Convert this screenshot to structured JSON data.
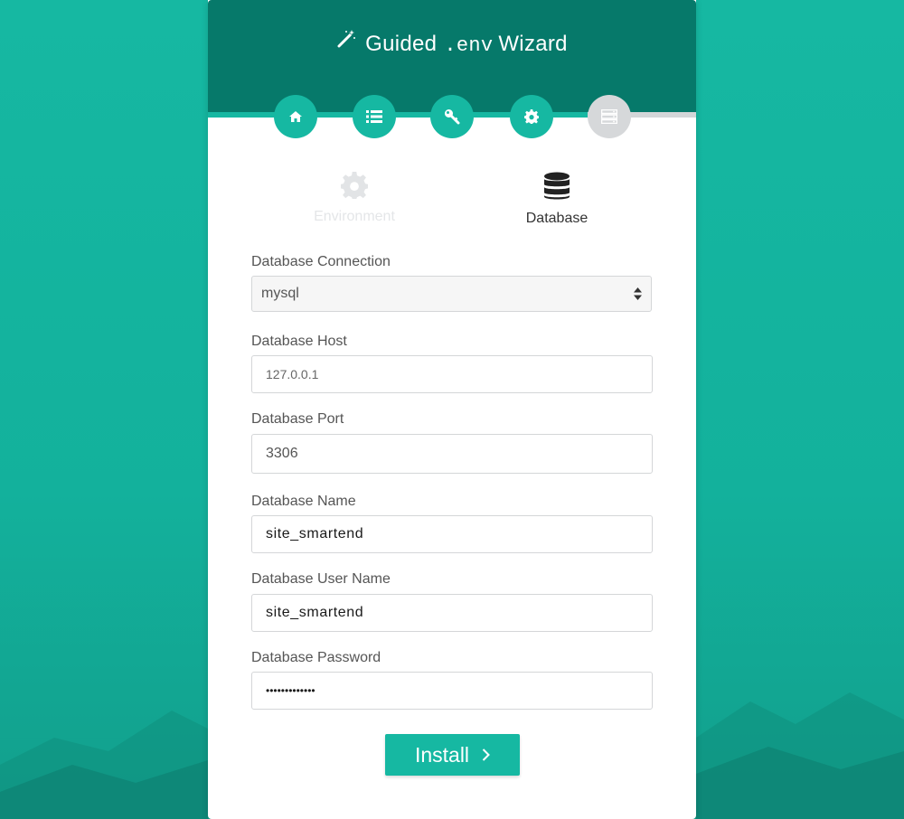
{
  "colors": {
    "background": "#16b8a2",
    "header": "#06796a",
    "accent": "#16b8a2",
    "inactive_step": "#d6d8da",
    "card": "#ffffff"
  },
  "header": {
    "title_part1": "Guided",
    "title_env": ".env",
    "title_part2": "Wizard",
    "icon": "magic-wand-icon"
  },
  "steps": [
    {
      "name": "home",
      "icon": "home-icon",
      "state": "complete"
    },
    {
      "name": "requirements",
      "icon": "list-icon",
      "state": "complete"
    },
    {
      "name": "permissions",
      "icon": "key-icon",
      "state": "complete"
    },
    {
      "name": "environment",
      "icon": "gear-icon",
      "state": "complete"
    },
    {
      "name": "database",
      "icon": "server-icon",
      "state": "current"
    }
  ],
  "progress": 0.78,
  "tabs": [
    {
      "label": "Environment",
      "icon": "gear-icon",
      "active": false
    },
    {
      "label": "Database",
      "icon": "database-icon",
      "active": true
    }
  ],
  "form": {
    "connection": {
      "label": "Database Connection",
      "value": "mysql"
    },
    "host": {
      "label": "Database Host",
      "value": "127.0.0.1"
    },
    "port": {
      "label": "Database Port",
      "value": "3306"
    },
    "name": {
      "label": "Database Name",
      "value": "site_smartend"
    },
    "username": {
      "label": "Database User Name",
      "value": "site_smartend"
    },
    "password": {
      "label": "Database Password",
      "value": "•••••••••••••"
    }
  },
  "install_button": {
    "label": "Install"
  }
}
